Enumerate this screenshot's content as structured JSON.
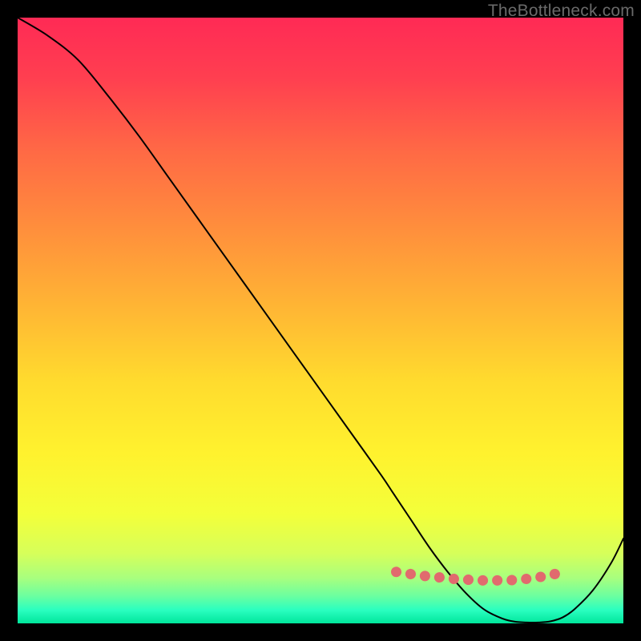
{
  "watermark": "TheBottleneck.com",
  "chart_data": {
    "type": "line",
    "title": "",
    "xlabel": "",
    "ylabel": "",
    "xlim": [
      0,
      100
    ],
    "ylim": [
      0,
      100
    ],
    "grid": false,
    "legend": false,
    "series": [
      {
        "name": "curve",
        "color": "#000000",
        "x": [
          0,
          5,
          10,
          15,
          20,
          25,
          30,
          35,
          40,
          45,
          50,
          55,
          60,
          62,
          65,
          68,
          71,
          74,
          77,
          80,
          82,
          84,
          86,
          88,
          90,
          92,
          95,
          98,
          100
        ],
        "y": [
          100,
          97,
          93,
          87,
          80.5,
          73.5,
          66.5,
          59.5,
          52.5,
          45.5,
          38.5,
          31.5,
          24.5,
          21.5,
          17,
          12.5,
          8.5,
          5,
          2.3,
          0.8,
          0.3,
          0.15,
          0.15,
          0.35,
          1.0,
          2.4,
          5.5,
          10,
          14
        ]
      },
      {
        "name": "highlight-dots",
        "color": "#e16a6e",
        "x": [
          62.5,
          64.5,
          66.5,
          68.5,
          70.5,
          72.5,
          74.5,
          76.5,
          78.5,
          80.5,
          82.5,
          84.5,
          86.5,
          88.5,
          90.5
        ],
        "y": [
          8.5,
          8.2,
          7.9,
          7.7,
          7.5,
          7.3,
          7.2,
          7.1,
          7.1,
          7.1,
          7.2,
          7.4,
          7.7,
          8.1,
          8.6
        ]
      }
    ],
    "background_gradient": {
      "stops": [
        {
          "offset": 0.0,
          "color": "#ff2a55"
        },
        {
          "offset": 0.1,
          "color": "#ff3f50"
        },
        {
          "offset": 0.22,
          "color": "#ff6945"
        },
        {
          "offset": 0.35,
          "color": "#ff8f3c"
        },
        {
          "offset": 0.48,
          "color": "#ffb634"
        },
        {
          "offset": 0.6,
          "color": "#ffdb2e"
        },
        {
          "offset": 0.72,
          "color": "#fff22e"
        },
        {
          "offset": 0.82,
          "color": "#f3ff3a"
        },
        {
          "offset": 0.885,
          "color": "#d6ff5a"
        },
        {
          "offset": 0.925,
          "color": "#a8ff7e"
        },
        {
          "offset": 0.955,
          "color": "#6bffa0"
        },
        {
          "offset": 0.978,
          "color": "#2affc0"
        },
        {
          "offset": 1.0,
          "color": "#00e59b"
        }
      ]
    }
  }
}
